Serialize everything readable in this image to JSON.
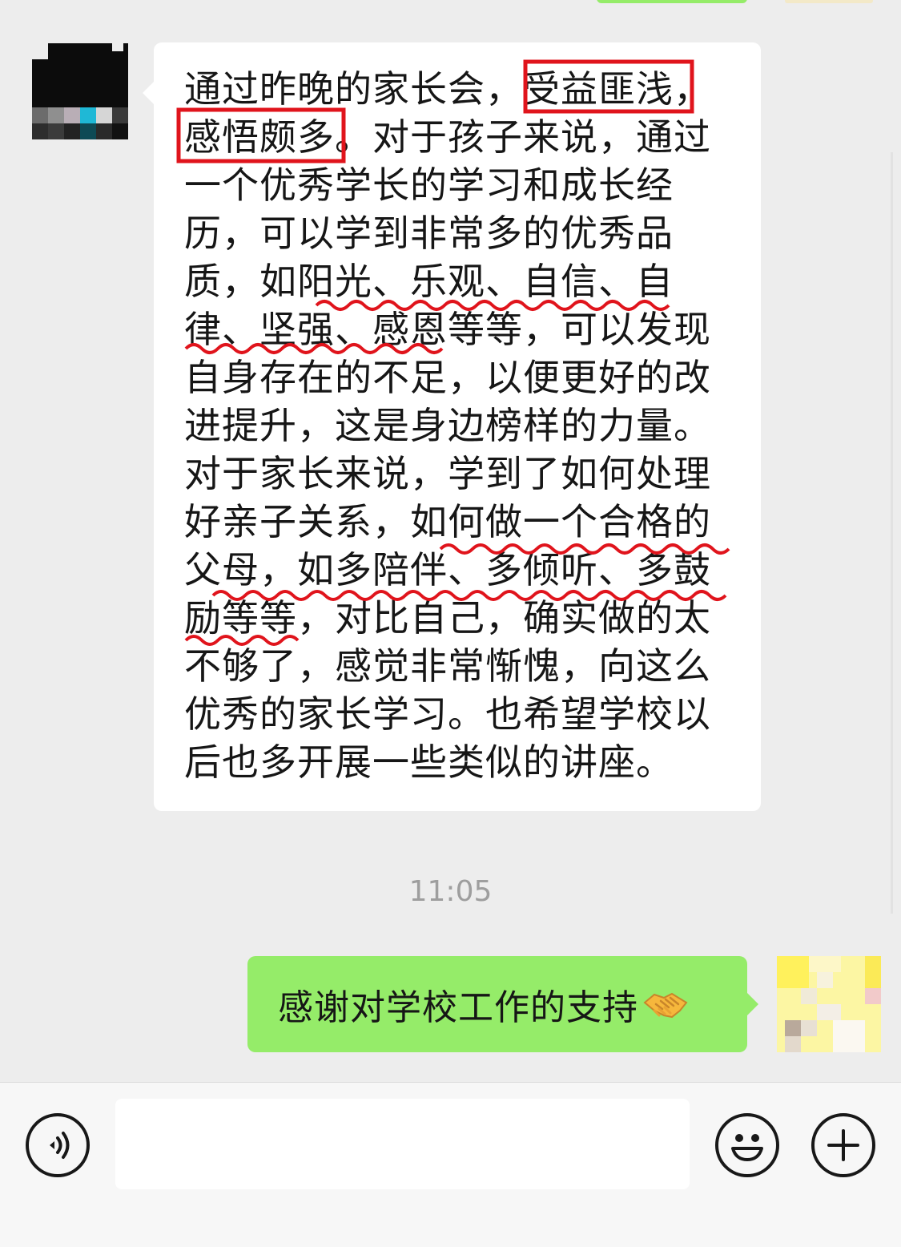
{
  "chat": {
    "incoming": {
      "lines": [
        "通过昨晚的家长会，受益匪浅，",
        "感悟颇多。对于孩子来说，通过",
        "一个优秀学长的学习和成长经",
        "历，可以学到非常多的优秀品",
        "质，如阳光、乐观、自信、自",
        "律、坚强、感恩等等，可以发现",
        "自身存在的不足，以便更好的改",
        "进提升，这是身边榜样的力量。",
        "对于家长来说，学到了如何处理",
        "好亲子关系，如何做一个合格的",
        "父母，如多陪伴、多倾听、多鼓",
        "励等等，对比自己，确实做的太",
        "不够了，感觉非常惭愧，向这么",
        "优秀的家长学习。也希望学校以",
        "后也多开展一些类似的讲座。"
      ],
      "highlight_color": "#E0141C",
      "highlighted_phrases": [
        "受益匪浅",
        "感悟颇多"
      ]
    },
    "timestamp": "11:05",
    "outgoing": {
      "text": "感谢对学校工作的支持",
      "emoji": "handshake-icon"
    }
  },
  "input_bar": {
    "message_value": "",
    "voice_icon": "voice-icon",
    "emoji_icon": "smiley-icon",
    "more_icon": "plus-icon"
  },
  "colors": {
    "background": "#EDEDED",
    "outgoing_bubble": "#95EC69",
    "incoming_bubble": "#FFFFFF",
    "annotation_red": "#E0141C"
  }
}
